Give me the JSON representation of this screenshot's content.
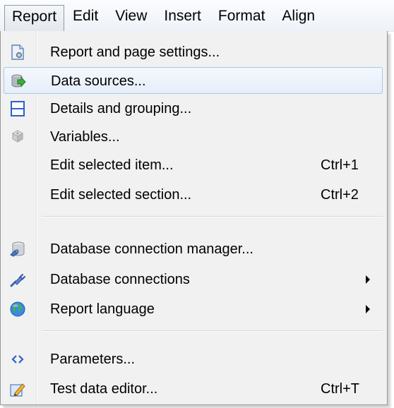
{
  "menubar": {
    "items": [
      {
        "label": "Report"
      },
      {
        "label": "Edit"
      },
      {
        "label": "View"
      },
      {
        "label": "Insert"
      },
      {
        "label": "Format"
      },
      {
        "label": "Align"
      }
    ]
  },
  "menu": {
    "items": [
      {
        "label": "Report and page settings...",
        "shortcut": "",
        "icon": "page-settings-icon"
      },
      {
        "label": "Data sources...",
        "shortcut": "",
        "icon": "data-sources-icon"
      },
      {
        "label": "Details and grouping...",
        "shortcut": "",
        "icon": "details-grouping-icon"
      },
      {
        "label": "Variables...",
        "shortcut": "",
        "icon": "variables-icon"
      },
      {
        "label": "Edit selected item...",
        "shortcut": "Ctrl+1",
        "icon": ""
      },
      {
        "label": "Edit selected section...",
        "shortcut": "Ctrl+2",
        "icon": ""
      },
      {
        "label": "Database connection manager...",
        "shortcut": "",
        "icon": "database-manager-icon"
      },
      {
        "label": "Database connections",
        "shortcut": "",
        "icon": "database-connections-icon"
      },
      {
        "label": "Report language",
        "shortcut": "",
        "icon": "globe-icon"
      },
      {
        "label": "Parameters...",
        "shortcut": "",
        "icon": "parameters-icon"
      },
      {
        "label": "Test data editor...",
        "shortcut": "Ctrl+T",
        "icon": "test-data-editor-icon"
      }
    ]
  },
  "colors": {
    "highlight_border": "#a9c5ea",
    "menu_background": "#f1f1f1"
  }
}
